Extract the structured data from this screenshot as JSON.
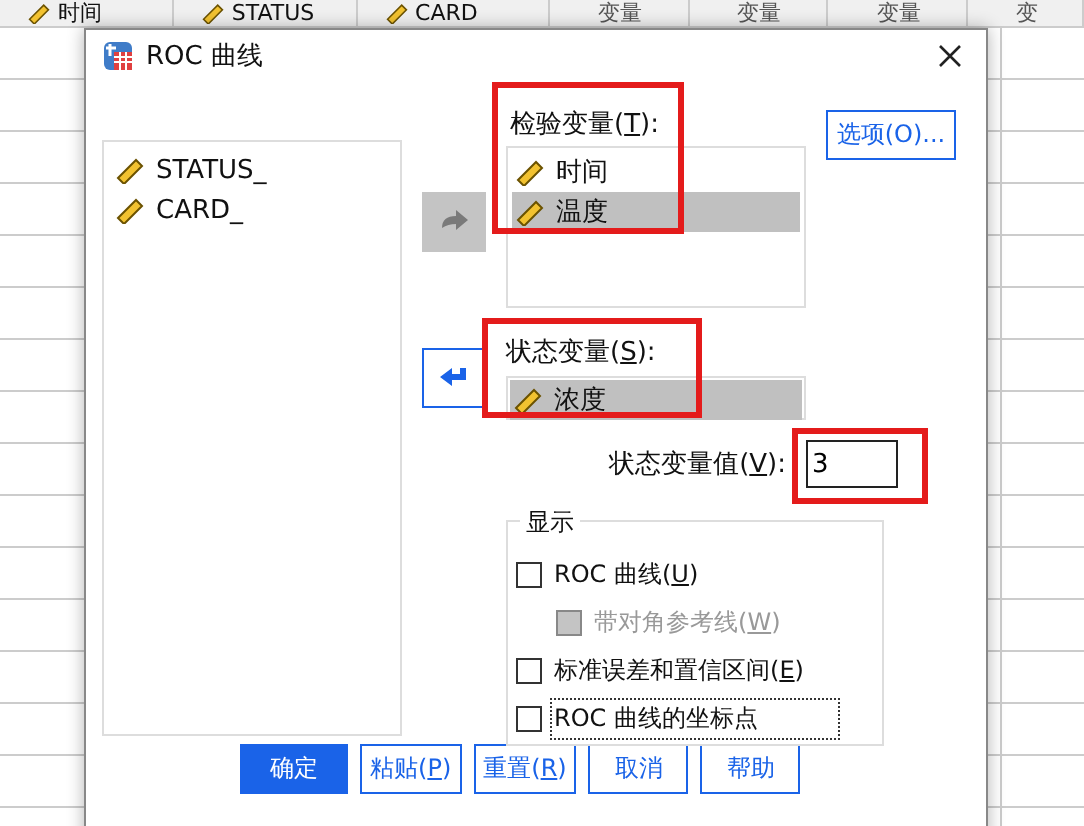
{
  "sheet": {
    "columns": [
      {
        "label": "时间",
        "kind": "scale"
      },
      {
        "label": "STATUS",
        "kind": "scale"
      },
      {
        "label": "CARD",
        "kind": "scale"
      },
      {
        "label": "变量",
        "kind": "empty"
      },
      {
        "label": "变量",
        "kind": "empty"
      },
      {
        "label": "变量",
        "kind": "empty"
      },
      {
        "label": "变",
        "kind": "empty"
      }
    ]
  },
  "dialog": {
    "title": "ROC 曲线",
    "source_list": [
      {
        "label": "STATUS_",
        "selected": false
      },
      {
        "label": "CARD_",
        "selected": false
      }
    ],
    "test_label": "检验变量(**T**):",
    "test_list": [
      {
        "label": "时间",
        "selected": false
      },
      {
        "label": "温度",
        "selected": true
      }
    ],
    "options_button": "选项(O)...",
    "state_label": "状态变量(**S**):",
    "state_var": {
      "label": "浓度",
      "selected": true
    },
    "value_label": "状态变量值(**V**):",
    "value": "3",
    "display_group": {
      "title": "显示",
      "items": [
        {
          "label": "ROC 曲线(**U**)",
          "checked": false,
          "disabled": false,
          "indent": false,
          "focused": false
        },
        {
          "label": "带对角参考线(**W**)",
          "checked": false,
          "disabled": true,
          "indent": true,
          "focused": false
        },
        {
          "label": "标准误差和置信区间(**E**)",
          "checked": false,
          "disabled": false,
          "indent": false,
          "focused": false
        },
        {
          "label": "ROC 曲线的坐标点",
          "checked": false,
          "disabled": false,
          "indent": false,
          "focused": true
        }
      ]
    },
    "buttons": [
      {
        "label": "确定",
        "kind": "primary"
      },
      {
        "label": "粘贴(**P**)",
        "kind": "normal"
      },
      {
        "label": "重置(**R**)",
        "kind": "normal"
      },
      {
        "label": "取消",
        "kind": "normal"
      },
      {
        "label": "帮助",
        "kind": "normal"
      }
    ]
  }
}
